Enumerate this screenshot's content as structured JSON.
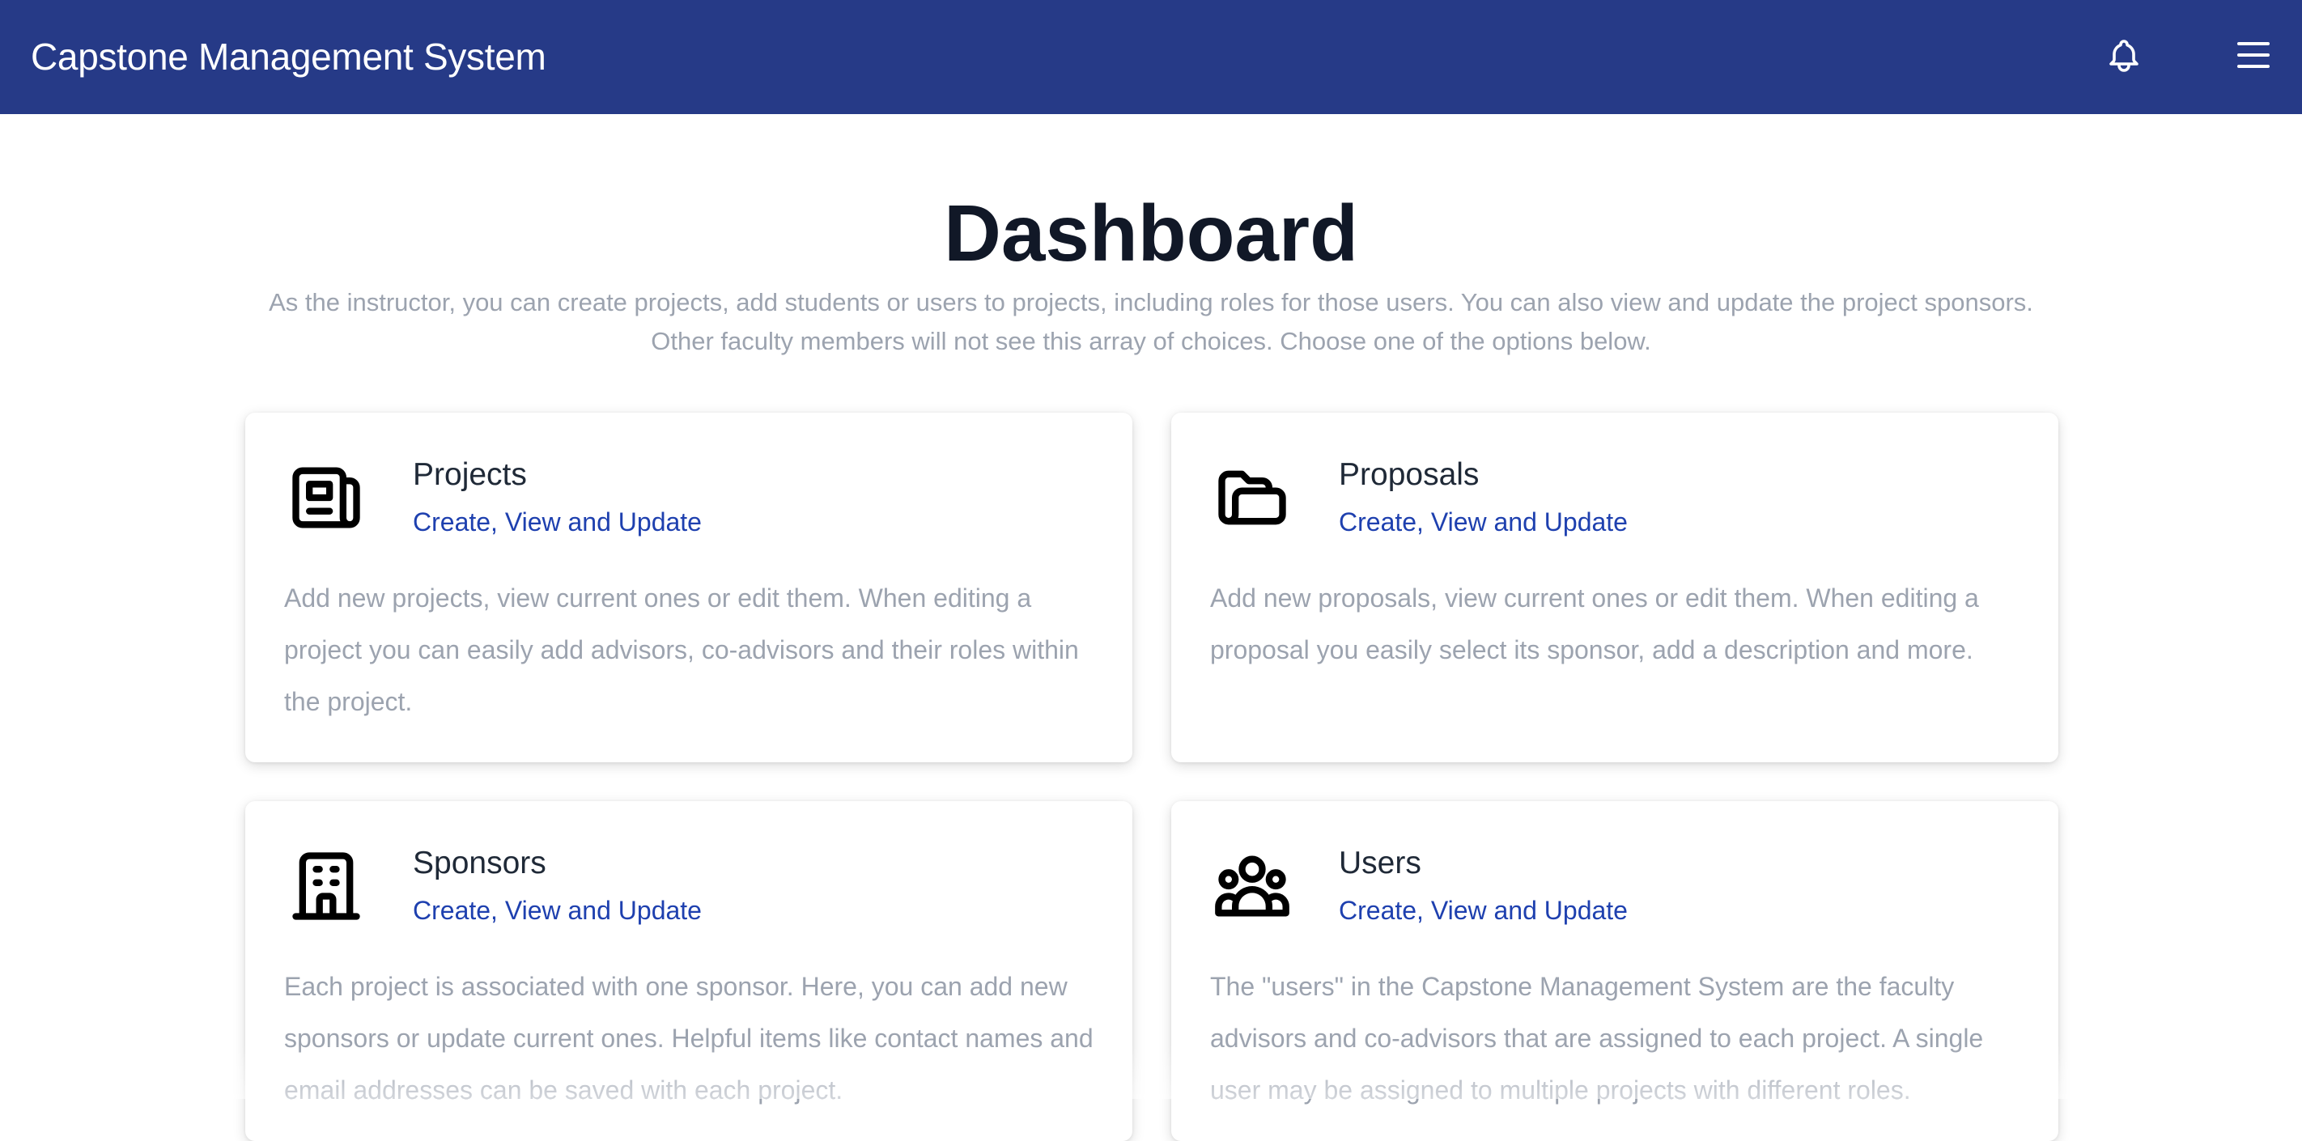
{
  "header": {
    "app_title": "Capstone Management System",
    "notifications_icon": "bell-icon",
    "menu_icon": "hamburger-menu-icon",
    "background_color": "#263a87"
  },
  "main": {
    "title": "Dashboard",
    "description": "As the instructor, you can create projects, add students or users to projects, including roles for those users. You can also view and update the project sponsors. Other faculty members will not see this array of choices. Choose one of the options below."
  },
  "cards": [
    {
      "icon": "newspaper-icon",
      "title": "Projects",
      "link": "Create, View and Update",
      "description": "Add new projects, view current ones or edit them. When editing a project you can easily add advisors, co-advisors and their roles within the project."
    },
    {
      "icon": "folder-open-icon",
      "title": "Proposals",
      "link": "Create, View and Update",
      "description": "Add new proposals, view current ones or edit them. When editing a proposal you easily select its sponsor, add a description and more."
    },
    {
      "icon": "office-building-icon",
      "title": "Sponsors",
      "link": "Create, View and Update",
      "description": "Each project is associated with one sponsor. Here, you can add new sponsors or update current ones. Helpful items like contact names and email addresses can be saved with each project."
    },
    {
      "icon": "user-group-icon",
      "title": "Users",
      "link": "Create, View and Update",
      "description": "The \"users\" in the Capstone Management System are the faculty advisors and co-advisors that are assigned to each project. A single user may be assigned to multiple projects with different roles."
    }
  ],
  "colors": {
    "link": "#1e40af",
    "muted_text": "#9ca3af",
    "heading": "#111827"
  }
}
